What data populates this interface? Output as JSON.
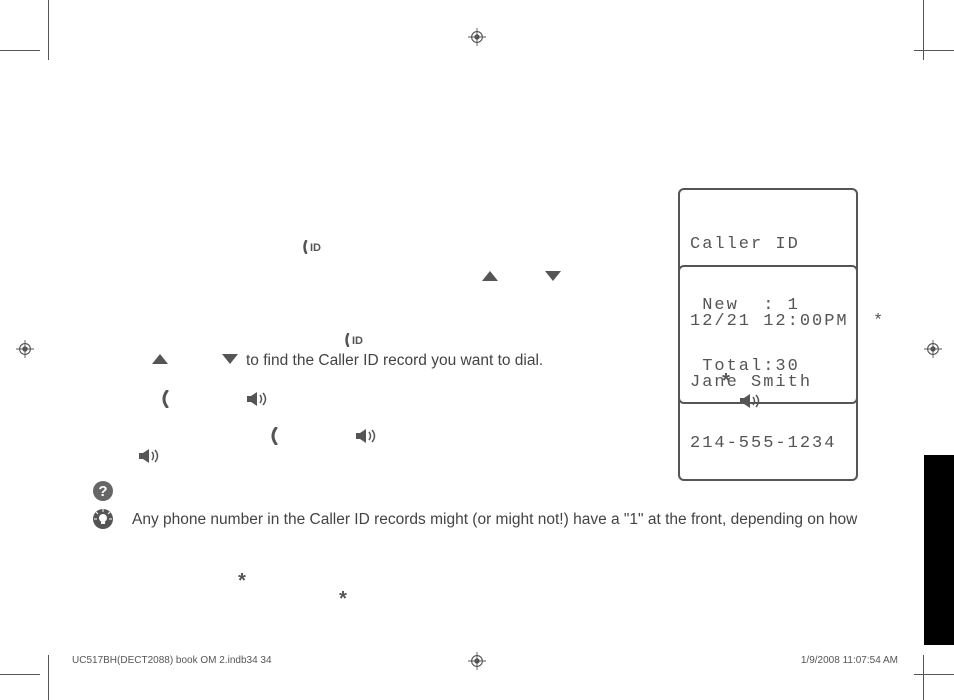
{
  "lcd1": {
    "line1": "Caller ID",
    "line2": " New  : 1",
    "line3": " Total:30"
  },
  "lcd2": {
    "line1": "12/21 12:00PM  *",
    "line2": "Jane Smith",
    "line3": "214-555-1234"
  },
  "body": {
    "instruction": "to find the Caller ID record you want to dial.",
    "tip": "Any phone number in the Caller ID records might (or might not!) have a \"1\" at the front, depending on how"
  },
  "footer": {
    "left": "UC517BH(DECT2088) book OM 2.indb34   34",
    "right": "1/9/2008   11:07:54 AM"
  }
}
